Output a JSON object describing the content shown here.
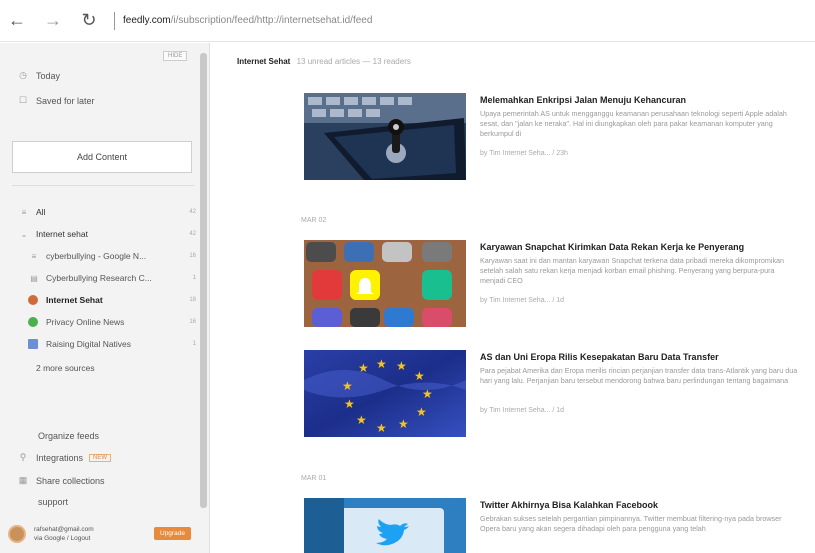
{
  "browser": {
    "back_glyph": "←",
    "forward_glyph": "→",
    "refresh_glyph": "↻",
    "url_host": "feedly.com",
    "url_path": "/i/subscription/feed/http://internetsehat.id/feed"
  },
  "sidebar": {
    "hide_label": "HIDE",
    "today": "Today",
    "saved": "Saved for later",
    "add_content": "Add Content",
    "all": {
      "label": "All",
      "count": "42"
    },
    "category": {
      "label": "Internet sehat",
      "count": "42"
    },
    "feeds": [
      {
        "label": "cyberbullying - Google N...",
        "count": "16",
        "color": "#777777"
      },
      {
        "label": "Cyberbullying Research C...",
        "count": "1",
        "color": "#555555"
      },
      {
        "label": "Internet Sehat",
        "count": "18",
        "color": "#d06a3a"
      },
      {
        "label": "Privacy Online News",
        "count": "16",
        "color": "#4caf50"
      },
      {
        "label": "Raising Digital Natives",
        "count": "1",
        "color": "#6d8fd6"
      }
    ],
    "more_sources": "2 more sources",
    "organize": "Organize feeds",
    "integrations": "Integrations",
    "new_badge": "NEW",
    "share": "Share collections",
    "support": "support",
    "user_email": "rafsehat@gmail.com",
    "user_sub": "via Google / Logout",
    "upgrade": "Upgrade"
  },
  "main": {
    "title": "Internet Sehat",
    "meta": "13 unread articles — 13 readers",
    "dates": [
      "MAR 02",
      "MAR 01"
    ],
    "articles": [
      {
        "title": "Melemahkan Enkripsi Jalan Menuju Kehancuran",
        "summary": "Upaya pemerintah AS untuk mengganggu keamanan perusahaan teknologi seperti Apple adalah sesat, dan \"jalan ke neraka\". Hal ini diungkapkan oleh para pakar keamanan komputer yang berkumpul di",
        "meta": "by Tim Internet Seha... / 23h"
      },
      {
        "title": "Karyawan Snapchat Kirimkan Data Rekan Kerja ke Penyerang",
        "summary": "Karyawan saat ini dan mantan karyawan Snapchat terkena data pribadi mereka dikompromikan setelah salah satu rekan kerja menjadi korban email phishing. Penyerang yang berpura-pura menjadi CEO",
        "meta": "by Tim Internet Seha... / 1d"
      },
      {
        "title": "AS dan Uni Eropa Rilis Kesepakatan Baru Data Transfer",
        "summary": "Para pejabat Amerika dan Eropa merilis rincian perjanjian transfer data trans-Atlantik yang baru dua hari yang lalu. Perjanjian baru tersebut mendorong bahwa baru perlindungan tentang bagaimana",
        "meta": "by Tim Internet Seha... / 1d"
      },
      {
        "title": "Twitter Akhirnya Bisa Kalahkan Facebook",
        "summary": "Gebrakan sukses setelah pergantian pimpinannya. Twitter membuat filtering-nya pada browser Opera baru yang akan segera dihadapi oleh para pengguna yang telah",
        "meta": ""
      }
    ]
  }
}
